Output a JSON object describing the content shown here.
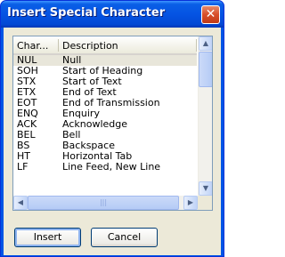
{
  "window": {
    "title": "Insert Special Character",
    "close_glyph": "✕"
  },
  "list": {
    "columns": [
      "Char...",
      "Description"
    ],
    "rows": [
      {
        "char": "NUL",
        "description": "Null"
      },
      {
        "char": "SOH",
        "description": "Start of Heading"
      },
      {
        "char": "STX",
        "description": "Start of Text"
      },
      {
        "char": "ETX",
        "description": "End of Text"
      },
      {
        "char": "EOT",
        "description": "End of Transmission"
      },
      {
        "char": "ENQ",
        "description": "Enquiry"
      },
      {
        "char": "ACK",
        "description": "Acknowledge"
      },
      {
        "char": "BEL",
        "description": "Bell"
      },
      {
        "char": "BS",
        "description": "Backspace"
      },
      {
        "char": "HT",
        "description": "Horizontal Tab"
      },
      {
        "char": "LF",
        "description": "Line Feed, New Line"
      }
    ],
    "selected_index": 0
  },
  "scrollbar": {
    "up_glyph": "▲",
    "down_glyph": "▼",
    "left_glyph": "◀",
    "right_glyph": "▶",
    "grip_glyph": "|||"
  },
  "buttons": {
    "insert_label": "Insert",
    "cancel_label": "Cancel"
  },
  "colors": {
    "titlebar": "#0554e3",
    "dialog_face": "#ece9d8",
    "close_button": "#d84e2a"
  },
  "icons": [
    "close-icon",
    "scroll-up-icon",
    "scroll-down-icon",
    "scroll-left-icon",
    "scroll-right-icon"
  ]
}
